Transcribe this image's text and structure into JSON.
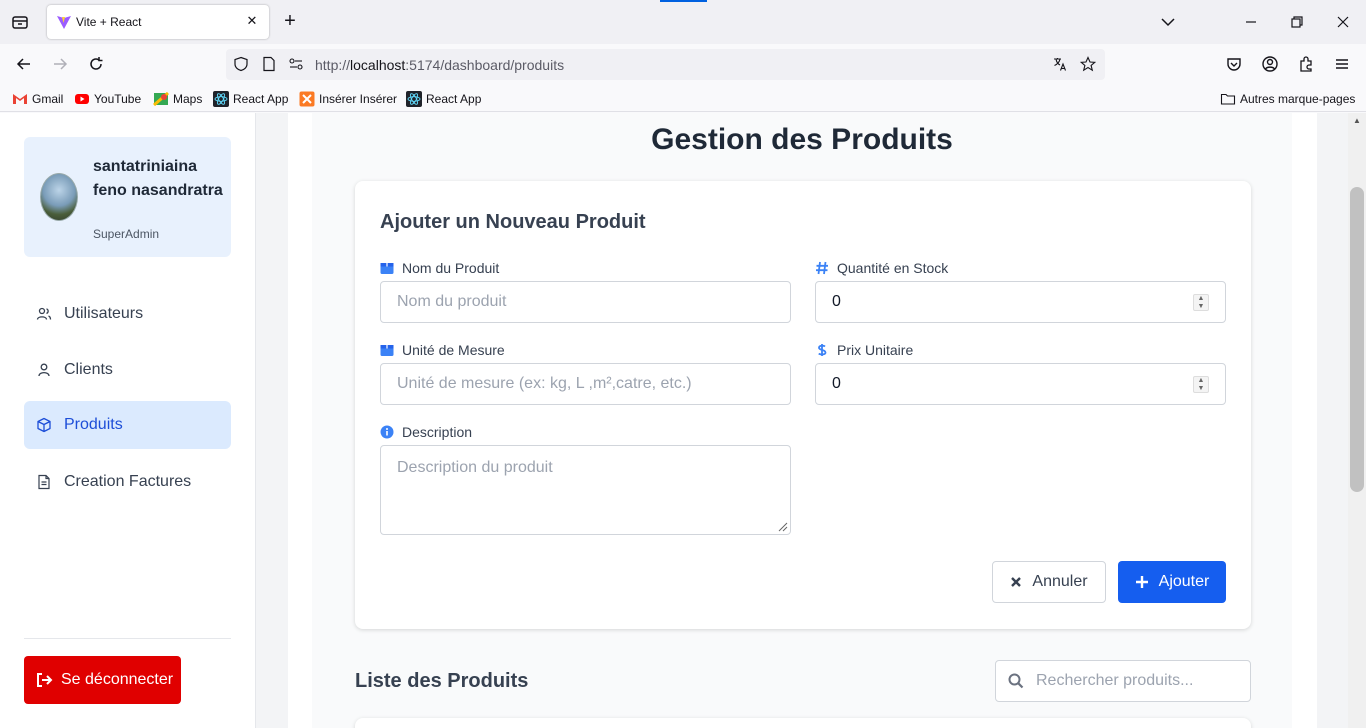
{
  "browser": {
    "tab_title": "Vite + React",
    "tab_close": "✕",
    "new_tab": "+",
    "url_prefix": "http://",
    "url_host": "localhost",
    "url_path": ":5174/dashboard/produits",
    "bookmarks": [
      {
        "label": "Gmail",
        "icon": "gmail-icon"
      },
      {
        "label": "YouTube",
        "icon": "youtube-icon"
      },
      {
        "label": "Maps",
        "icon": "maps-icon"
      },
      {
        "label": "React App",
        "icon": "react-icon"
      },
      {
        "label": "Insérer Insérer",
        "icon": "xampp-icon"
      },
      {
        "label": "React App",
        "icon": "react-icon"
      }
    ],
    "other_bookmarks": "Autres marque-pages"
  },
  "sidebar": {
    "user": {
      "name": "santatriniaina feno nasandratra",
      "role": "SuperAdmin"
    },
    "items": [
      {
        "label": "Utilisateurs",
        "icon": "users-icon",
        "active": false
      },
      {
        "label": "Clients",
        "icon": "user-icon",
        "active": false
      },
      {
        "label": "Produits",
        "icon": "box-icon",
        "active": true
      },
      {
        "label": "Creation Factures",
        "icon": "file-icon",
        "active": false
      }
    ],
    "logout_label": "Se déconnecter"
  },
  "main": {
    "title": "Gestion des Produits",
    "form": {
      "title": "Ajouter un Nouveau Produit",
      "name_label": "Nom du Produit",
      "name_placeholder": "Nom du produit",
      "qty_label": "Quantité en Stock",
      "qty_value": "0",
      "unit_label": "Unité de Mesure",
      "unit_placeholder": "Unité de mesure (ex: kg, L ,m²,catre, etc.)",
      "price_label": "Prix Unitaire",
      "price_value": "0",
      "desc_label": "Description",
      "desc_placeholder": "Description du produit",
      "cancel_label": "Annuler",
      "add_label": "Ajouter"
    },
    "list_title": "Liste des Produits",
    "search_placeholder": "Rechercher produits..."
  },
  "colors": {
    "accent": "#155eef",
    "active_bg": "#dbeafe",
    "danger": "#e00000"
  }
}
